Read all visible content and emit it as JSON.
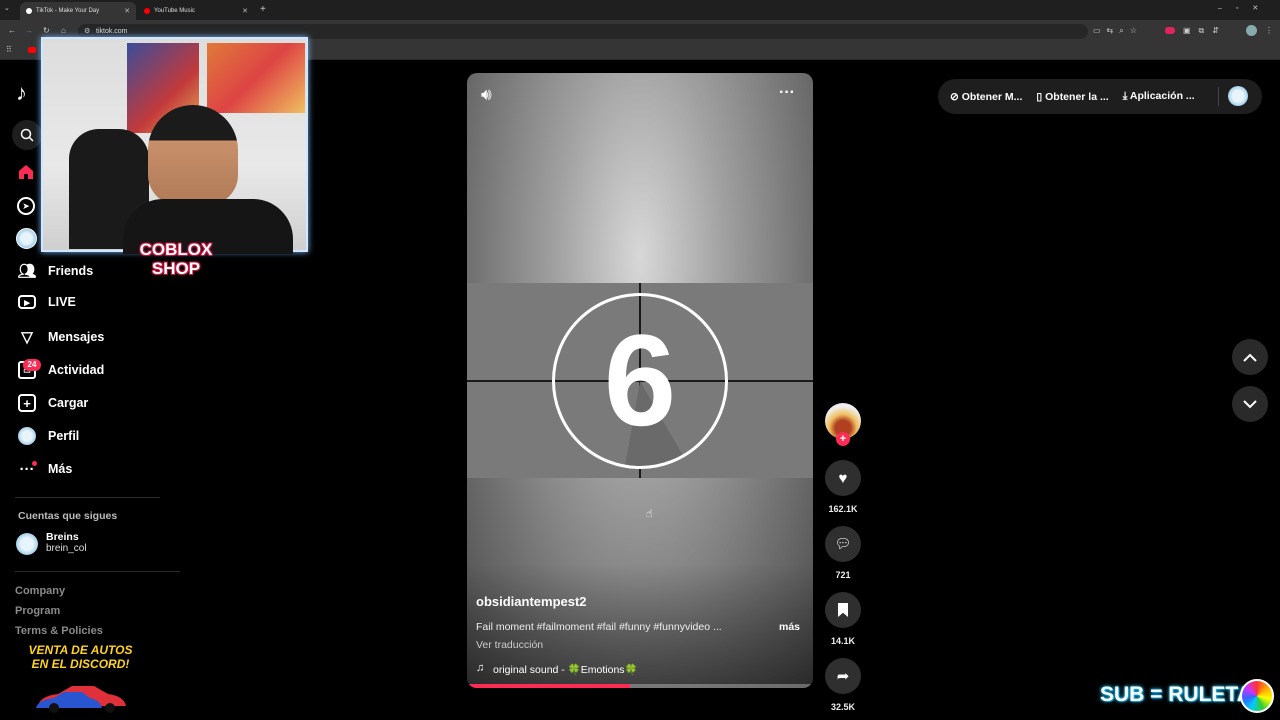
{
  "browser": {
    "tabs": [
      {
        "title": "TikTok - Make Your Day"
      },
      {
        "title": "YouTube Music"
      }
    ],
    "url": "tiktok.com"
  },
  "sidebar": {
    "nav": [
      {
        "label": "Friends",
        "icon": "friends-icon"
      },
      {
        "label": "LIVE",
        "icon": "live-icon"
      },
      {
        "label": "Mensajes",
        "icon": "messages-icon"
      },
      {
        "label": "Actividad",
        "icon": "activity-icon",
        "badge": "24"
      },
      {
        "label": "Cargar",
        "icon": "upload-icon"
      },
      {
        "label": "Perfil",
        "icon": "profile-icon"
      },
      {
        "label": "Más",
        "icon": "more-icon"
      }
    ],
    "following_title": "Cuentas que sigues",
    "following": [
      {
        "name": "Breins",
        "handle": "brein_col"
      }
    ],
    "footer": [
      "Company",
      "Program",
      "Terms & Policies"
    ]
  },
  "overlays": {
    "shop_line1": "COBLOX",
    "shop_line2": "SHOP",
    "promo_line1": "VENTA DE AUTOS",
    "promo_line2": "EN EL DISCORD!",
    "roulette": "SUB = RULETA"
  },
  "video": {
    "countdown": "6",
    "author": "obsidiantempest2",
    "caption": "Fail moment #failmoment #fail #funny #funnyvideo ...",
    "more": "más",
    "translate": "Ver traducción",
    "sound": "original sound - 🍀Emotions🍀",
    "progress": 0.47
  },
  "actions": {
    "likes": "162.1K",
    "comments": "721",
    "saves": "14.1K",
    "shares": "32.5K"
  },
  "header_actions": [
    {
      "label": "Obtener M...",
      "icon": "coin-icon"
    },
    {
      "label": "Obtener la ...",
      "icon": "phone-icon"
    },
    {
      "label": "Aplicación ...",
      "icon": "download-icon"
    }
  ],
  "colors": {
    "accent": "#fe2c55",
    "badge": "#fe2c55"
  }
}
